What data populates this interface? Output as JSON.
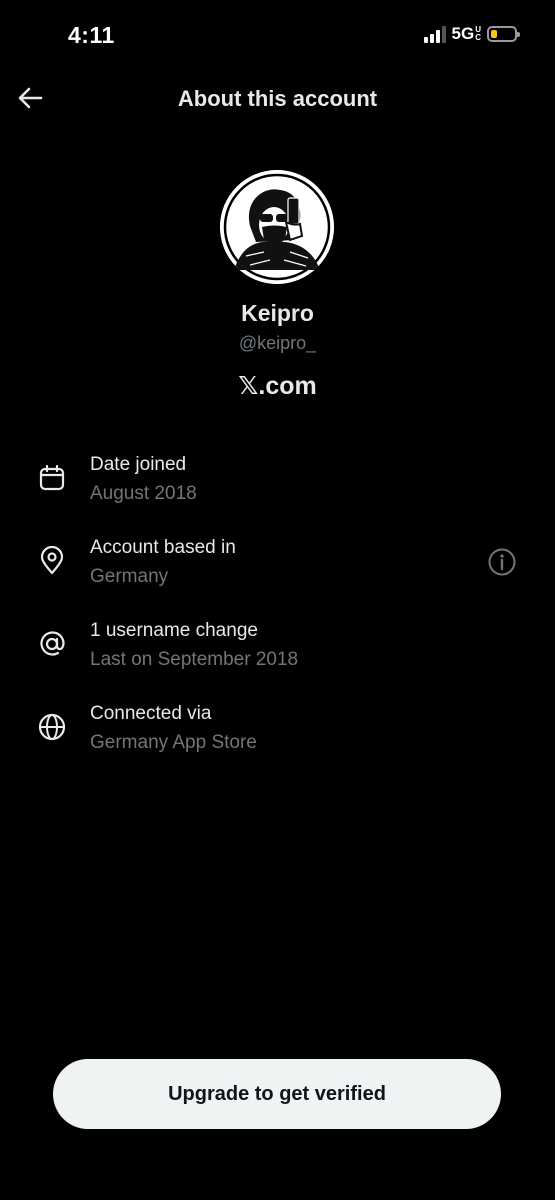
{
  "status_bar": {
    "time": "4:11",
    "network": "5G",
    "network_suffix_top": "U",
    "network_suffix_bottom": "C",
    "battery_level": 0.25,
    "battery_color": "#f5c518"
  },
  "header": {
    "title": "About this account",
    "back_icon": "arrow-left-icon"
  },
  "profile": {
    "display_name": "Keipro",
    "handle": "@keipro_",
    "site": "𝕏.com"
  },
  "info_rows": [
    {
      "icon": "calendar-icon",
      "title": "Date joined",
      "subtitle": "August 2018"
    },
    {
      "icon": "location-pin-icon",
      "title": "Account based in",
      "subtitle": "Germany",
      "action_icon": "info-icon"
    },
    {
      "icon": "at-sign-icon",
      "title": "1 username change",
      "subtitle": "Last on September 2018"
    },
    {
      "icon": "globe-icon",
      "title": "Connected via",
      "subtitle": "Germany App Store"
    }
  ],
  "footer": {
    "upgrade_label": "Upgrade to get verified"
  },
  "colors": {
    "background": "#000000",
    "primary_text": "#e7e9ea",
    "secondary_text": "#71767b",
    "button_bg": "#eff3f4",
    "button_text": "#0f1419"
  }
}
